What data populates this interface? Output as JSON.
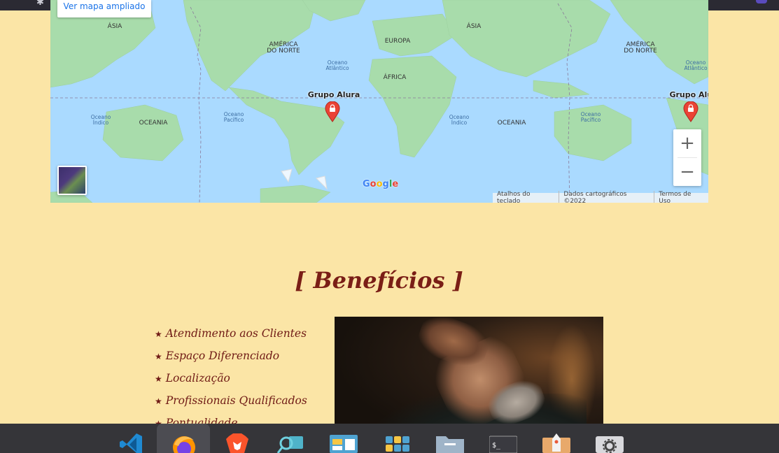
{
  "browser": {
    "colors": {
      "chrome": "#2b2a33",
      "urlbar": "#1c1b22"
    }
  },
  "map": {
    "enlarge_link": "Ver mapa ampliado",
    "continents": {
      "asia_1": "ÁSIA",
      "north_america_1": "AMÉRICA\nDO NORTE",
      "europe": "EUROPA",
      "asia_2": "ÁSIA",
      "north_america_2": "AMÉRICA\nDO NORTE",
      "africa": "ÁFRICA"
    },
    "oceans": {
      "atlantic_1": "Oceano\nAtlântico",
      "atlantic_2": "Oceano\nAtlântico",
      "indian_1": "Oceano\nÍndico",
      "indian_2": "Oceano\nÍndico",
      "pacific_1": "Oceano\nPacífico",
      "pacific_2": "Oceano\nPacífico",
      "oceania_1": "OCEANIA",
      "oceania_2": "OCEANIA"
    },
    "markers": {
      "place_1": "Grupo Alura",
      "place_2": "Grupo Alur"
    },
    "zoom_in": "+",
    "zoom_out": "−",
    "logo": "Google",
    "attribution": {
      "shortcuts": "Atalhos do teclado",
      "data": "Dados cartográficos ©2022",
      "terms": "Termos de Uso"
    },
    "colors": {
      "water": "#aadaff",
      "land": "#a8dcab",
      "land_dark": "#8fcf94",
      "pin": "#ea4335"
    }
  },
  "benefits": {
    "title": "[ Benefícios ]",
    "items": [
      "Atendimento aos Clientes",
      "Espaço Diferenciado",
      "Localização",
      "Profissionais Qualificados",
      "Pontualidade"
    ],
    "bullet": "★"
  },
  "page": {
    "colors": {
      "background": "#fbe5a6",
      "accent": "#7a1e16"
    }
  },
  "dock": {
    "apps": [
      {
        "icon": "vscode-icon"
      },
      {
        "icon": "firefox-icon",
        "active": true
      },
      {
        "icon": "brave-icon"
      },
      {
        "icon": "search-tool-icon"
      },
      {
        "icon": "window-layout-icon"
      },
      {
        "icon": "app-grid-icon"
      },
      {
        "icon": "folder-icon"
      },
      {
        "icon": "terminal-icon"
      },
      {
        "icon": "installer-icon"
      },
      {
        "icon": "settings-icon"
      }
    ]
  }
}
